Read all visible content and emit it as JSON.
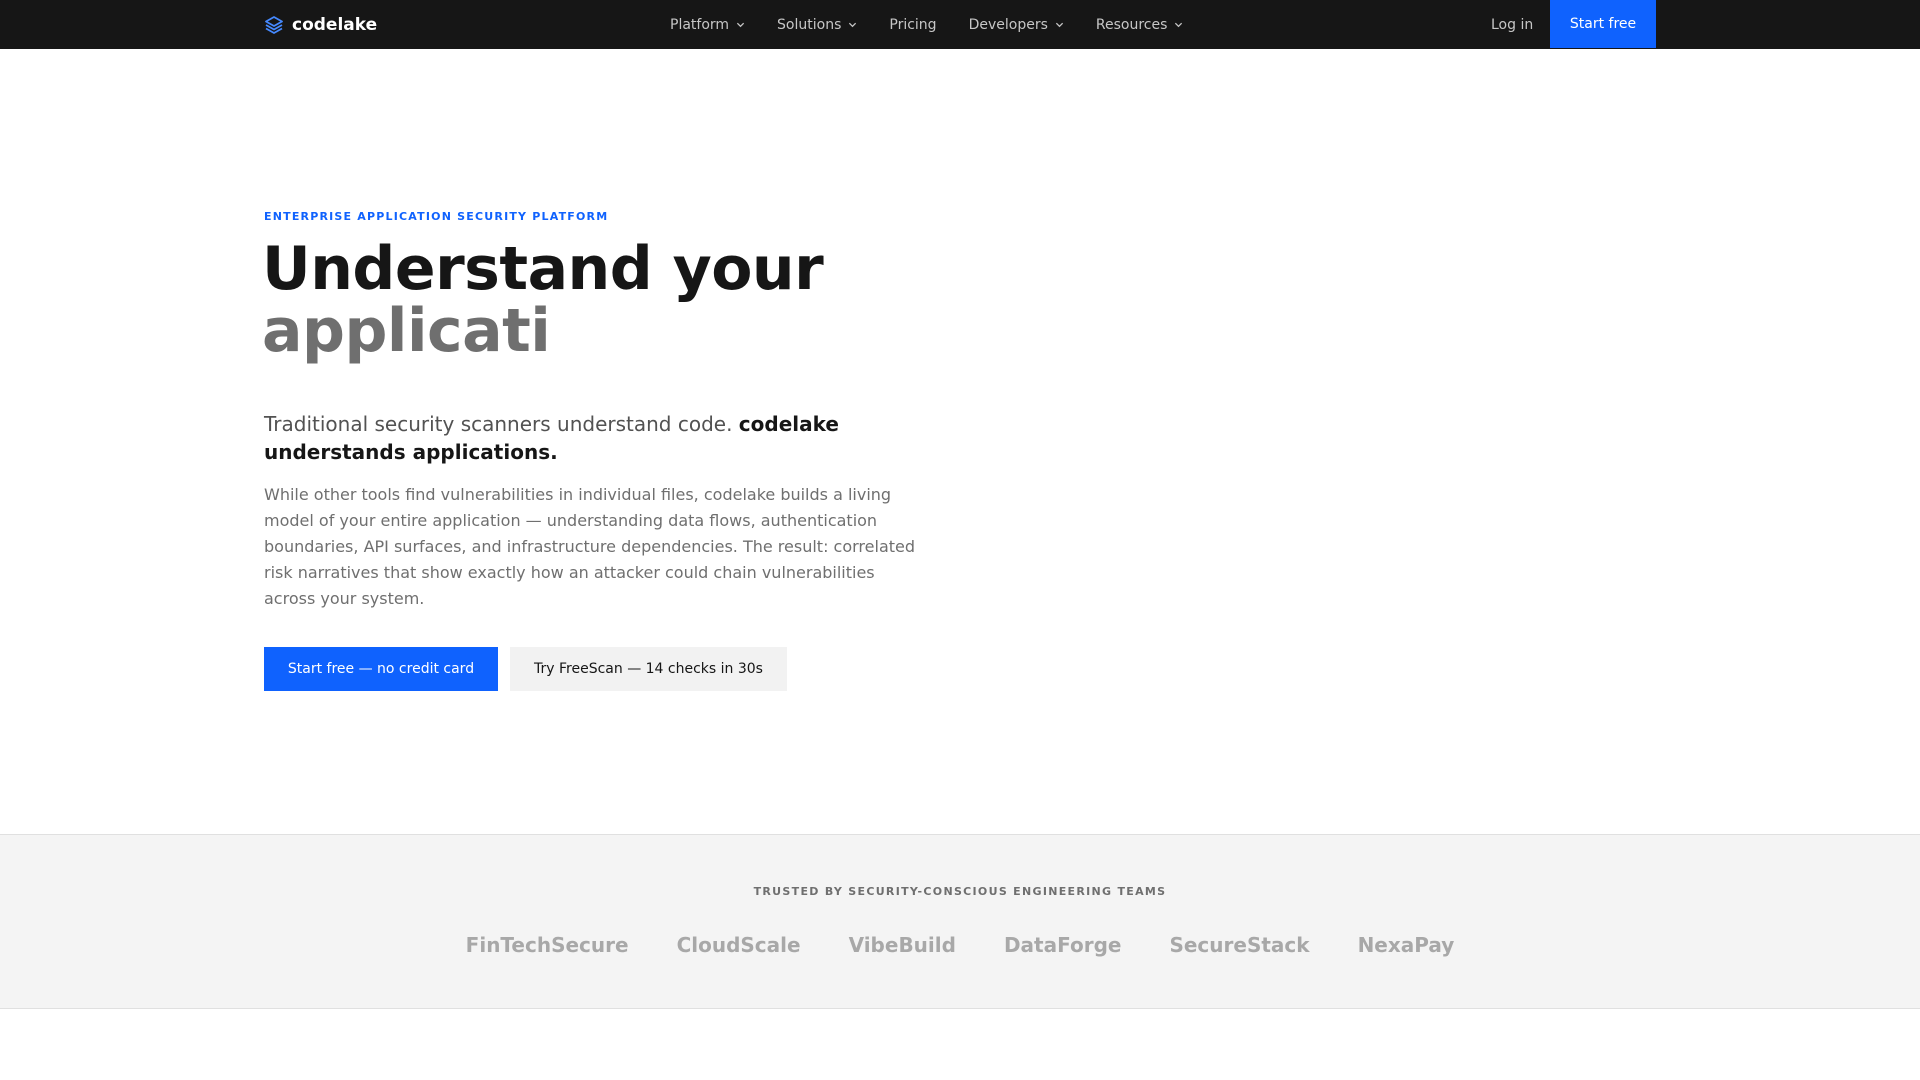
{
  "nav": {
    "brand": "codelake",
    "items": [
      {
        "label": "Platform",
        "dropdown": true
      },
      {
        "label": "Solutions",
        "dropdown": true
      },
      {
        "label": "Pricing",
        "dropdown": false
      },
      {
        "label": "Developers",
        "dropdown": true
      },
      {
        "label": "Resources",
        "dropdown": true
      }
    ],
    "login": "Log in",
    "start": "Start free"
  },
  "hero": {
    "eyebrow": "ENTERPRISE APPLICATION SECURITY PLATFORM",
    "headline_line1": "Understand your",
    "headline_line2": "applicati",
    "lead_plain": "Traditional security scanners understand code. ",
    "lead_bold": "codelake understands applications.",
    "body": "While other tools find vulnerabilities in individual files, codelake builds a living model of your entire application — understanding data flows, authentication boundaries, API surfaces, and infrastructure dependencies. The result: correlated risk narratives that show exactly how an attacker could chain vulnerabilities across your system.",
    "cta_primary": "Start free — no credit card",
    "cta_secondary": "Try FreeScan — 14 checks in 30s"
  },
  "trusted": {
    "title": "TRUSTED BY SECURITY-CONSCIOUS ENGINEERING TEAMS",
    "logos": [
      "FinTechSecure",
      "CloudScale",
      "VibeBuild",
      "DataForge",
      "SecureStack",
      "NexaPay"
    ]
  },
  "colors": {
    "nav_bg": "#161616",
    "accent": "#0f62fe",
    "muted_text": "#6f6f6f",
    "logo_gray": "#a8a8a8",
    "band_bg": "#f4f4f4"
  }
}
